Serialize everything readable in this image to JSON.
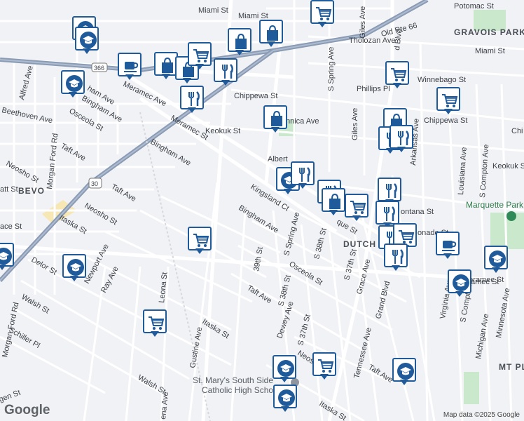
{
  "map": {
    "attribution": "Map data ©2025 Google",
    "logo": "Google",
    "colors": {
      "road": "#ffffff",
      "highway": "#8a9bb4",
      "background": "#f1f2f5",
      "park": "#c9e8cc",
      "marker": "#1f5a9a"
    }
  },
  "areas": [
    {
      "id": "bevo",
      "text": "BEVO"
    },
    {
      "id": "dutchtown",
      "text": "DUTCH"
    },
    {
      "id": "gravois-park",
      "text": "GRAVOIS PARK"
    },
    {
      "id": "mt-pleasant",
      "text": "MT PL"
    }
  ],
  "places": [
    {
      "id": "marquette-park",
      "text": "Marquette Park"
    },
    {
      "id": "st-marys",
      "line1": "St. Mary's South Side",
      "line2": "Catholic High School"
    }
  ],
  "roads": [
    {
      "id": "miami-st-1",
      "text": "Miami St"
    },
    {
      "id": "miami-st-2",
      "text": "Miami St"
    },
    {
      "id": "miami-st-3",
      "text": "Miami St"
    },
    {
      "id": "old-rte-66",
      "text": "Old Rte 66"
    },
    {
      "id": "potomac-st",
      "text": "Potomac St"
    },
    {
      "id": "tholozan-ave",
      "text": "Tholozan Ave"
    },
    {
      "id": "winnebago-st",
      "text": "Winnebago St"
    },
    {
      "id": "phillips-pl",
      "text": "Phillips Pl"
    },
    {
      "id": "chippewa-st-1",
      "text": "Chippewa St"
    },
    {
      "id": "chippewa-st-2",
      "text": "Chippewa St"
    },
    {
      "id": "chippewa-st-3",
      "text": "Chi"
    },
    {
      "id": "meramec-ave-label",
      "text": "Meramec Ave"
    },
    {
      "id": "meramec-st-1",
      "text": "Meramec St"
    },
    {
      "id": "meramec-st-2",
      "text": "Meramec St"
    },
    {
      "id": "bingham-ave-1",
      "text": "Bingham Ave"
    },
    {
      "id": "bingham-ave-2",
      "text": "Bingham Ave"
    },
    {
      "id": "bingham-ave-3",
      "text": "Bingham Ave"
    },
    {
      "id": "osceola-st-1",
      "text": "Osceola St"
    },
    {
      "id": "osceola-st-2",
      "text": "Osceola St"
    },
    {
      "id": "taft-ave-1",
      "text": "Taft Ave"
    },
    {
      "id": "taft-ave-2",
      "text": "Taft Ave"
    },
    {
      "id": "taft-ave-3",
      "text": "Taft Ave"
    },
    {
      "id": "taft-ave-4",
      "text": "Taft Ave"
    },
    {
      "id": "neosho-st-1",
      "text": "Neosho St"
    },
    {
      "id": "neosho-st-2",
      "text": "Neosho St"
    },
    {
      "id": "neosho-st-3",
      "text": "Neos"
    },
    {
      "id": "itaska-st-1",
      "text": "Itaska St"
    },
    {
      "id": "itaska-st-2",
      "text": "Itaska St"
    },
    {
      "id": "itaska-st-3",
      "text": "Itaska St"
    },
    {
      "id": "delor-st",
      "text": "Delor St"
    },
    {
      "id": "walsh-st-1",
      "text": "Walsh St"
    },
    {
      "id": "walsh-st-2",
      "text": "Walsh St"
    },
    {
      "id": "schiller-pl",
      "text": "Schiller Pl"
    },
    {
      "id": "beethoven-ave",
      "text": "Beethoven Ave"
    },
    {
      "id": "alfred-ave",
      "text": "Alfred Ave"
    },
    {
      "id": "morgan-ford-rd-1",
      "text": "Morgan Ford Rd"
    },
    {
      "id": "morgan-ford-rd-2",
      "text": "Morgan Ford Rd"
    },
    {
      "id": "newport-ave",
      "text": "Newport Ave"
    },
    {
      "id": "ray-ave",
      "text": "Ray Ave"
    },
    {
      "id": "leona-st",
      "text": "Leona St"
    },
    {
      "id": "gustine-ave",
      "text": "Gustine Ave"
    },
    {
      "id": "keokuk-st-1",
      "text": "Keokuk St"
    },
    {
      "id": "keokuk-st-2",
      "text": "Keokuk St"
    },
    {
      "id": "kingsland-ct",
      "text": "Kingsland Ct"
    },
    {
      "id": "albert",
      "text": "Albert"
    },
    {
      "id": "s-spring-ave-1",
      "text": "S Spring Ave"
    },
    {
      "id": "s-spring-ave-2",
      "text": "S Spring Ave"
    },
    {
      "id": "giles-ave-1",
      "text": "Giles Ave"
    },
    {
      "id": "giles-ave-2",
      "text": "Giles Ave"
    },
    {
      "id": "39th-st",
      "text": "39th St"
    },
    {
      "id": "s-38th-st-1",
      "text": "S 38th St"
    },
    {
      "id": "s-38th-st-2",
      "text": "S 38th St"
    },
    {
      "id": "s-37th-st-1",
      "text": "S 37th St"
    },
    {
      "id": "s-37th-st-2",
      "text": "S 37th St"
    },
    {
      "id": "dewey-ave",
      "text": "Dewey Ave"
    },
    {
      "id": "grace-ave",
      "text": "Grace Ave"
    },
    {
      "id": "grand-blvd-1",
      "text": "Grand Blvd"
    },
    {
      "id": "grand-blvd-2",
      "text": "d Blvd"
    },
    {
      "id": "tennessee-ave",
      "text": "Tennessee Ave"
    },
    {
      "id": "virginia-ave",
      "text": "Virginia Ave"
    },
    {
      "id": "louisiana-ave",
      "text": "Louisiana Ave"
    },
    {
      "id": "s-compton-ave-1",
      "text": "S Compton Ave"
    },
    {
      "id": "s-compton-ave-2",
      "text": "S Compton"
    },
    {
      "id": "arkansas-ave",
      "text": "Arkansas Ave"
    },
    {
      "id": "michigan-ave",
      "text": "Michigan Ave"
    },
    {
      "id": "minnesota-ave",
      "text": "Minnesota Ave"
    },
    {
      "id": "fontana-st",
      "text": "ontana St"
    },
    {
      "id": "gasconade-st",
      "text": "onade St"
    },
    {
      "id": "ramec-st",
      "text": "amec St"
    },
    {
      "id": "quincy-st",
      "text": "que St"
    },
    {
      "id": "nnica-ave",
      "text": "nnica Ave"
    },
    {
      "id": "route-30",
      "text": "30"
    },
    {
      "id": "route-366",
      "text": "366"
    },
    {
      "id": "att-st",
      "text": "att St"
    },
    {
      "id": "ace-st",
      "text": "ace St"
    },
    {
      "id": "ham-ave",
      "text": "ham Ave"
    },
    {
      "id": "gen-st",
      "text": "gen St"
    },
    {
      "id": "ena-ave",
      "text": "ena Ave"
    }
  ],
  "markers": [
    {
      "type": "school",
      "icon": "school-icon"
    },
    {
      "type": "shopping",
      "icon": "shopping-bag-icon"
    },
    {
      "type": "grocery",
      "icon": "shopping-cart-icon"
    },
    {
      "type": "restaurant",
      "icon": "restaurant-icon"
    },
    {
      "type": "cafe",
      "icon": "cafe-icon"
    }
  ]
}
